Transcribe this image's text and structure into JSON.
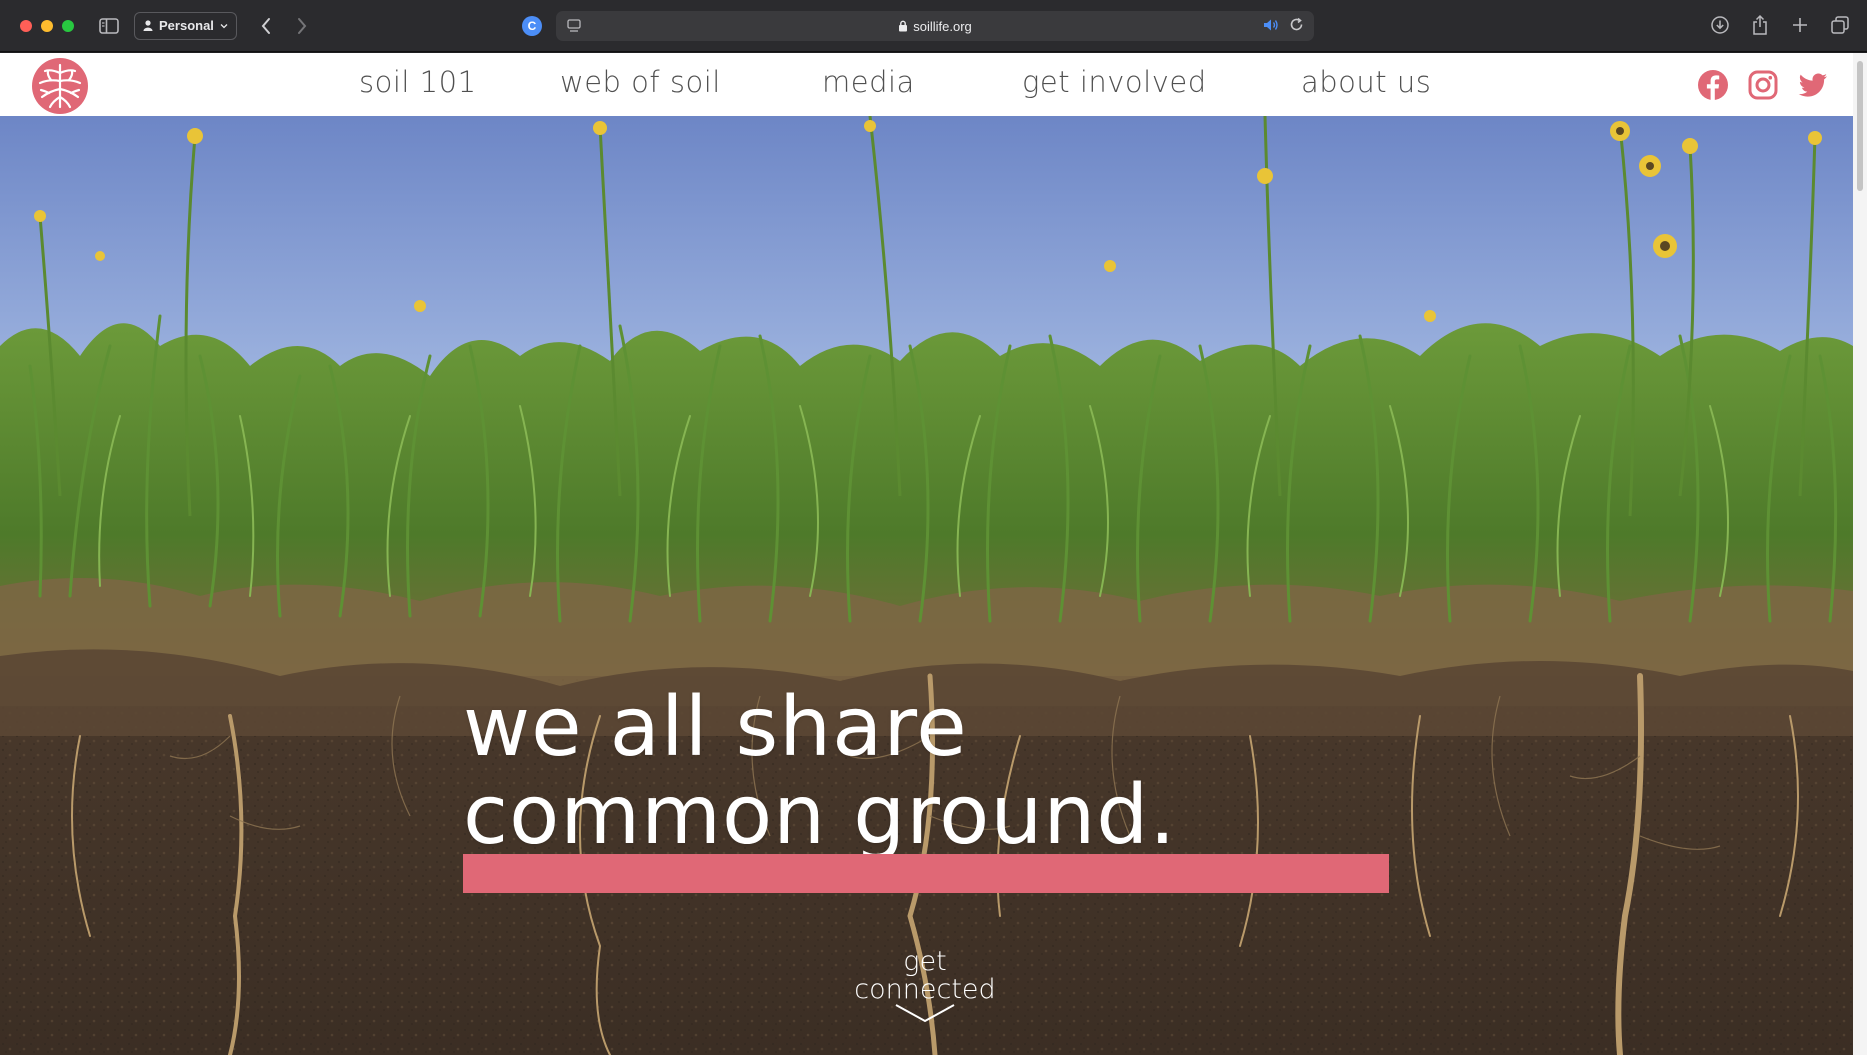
{
  "browser": {
    "profile_label": "Personal",
    "url": "soillife.org",
    "extension_letter": "C"
  },
  "site": {
    "nav": [
      {
        "label": "soil 101"
      },
      {
        "label": "web of soil"
      },
      {
        "label": "media"
      },
      {
        "label": "get involved"
      },
      {
        "label": "about us"
      }
    ],
    "social": [
      "facebook-icon",
      "instagram-icon",
      "twitter-icon"
    ],
    "brand_color": "#e06876"
  },
  "hero": {
    "headline_line1": "we all share",
    "headline_line2": "common ground.",
    "cta_line1": "get",
    "cta_line2": "connected"
  }
}
